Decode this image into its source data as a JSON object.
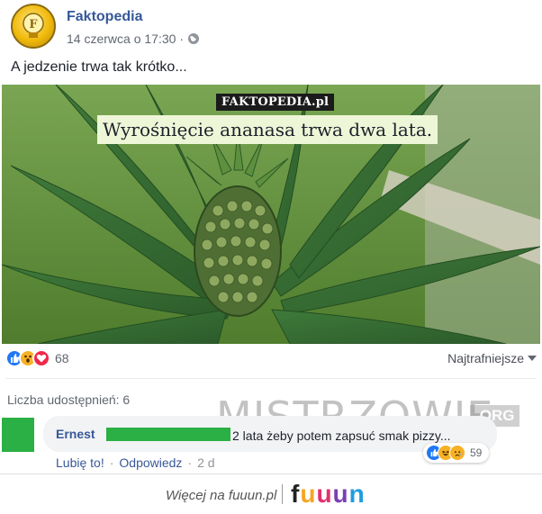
{
  "post": {
    "page_name": "Faktopedia",
    "date": "14 czerwca o 17:30",
    "date_separator": "·",
    "caption": "A jedzenie trwa tak krótko...",
    "image": {
      "brand_tag": "FAKTOPEDIA.pl",
      "fact_text": "Wyrośnięcie ananasa trwa dwa lata."
    }
  },
  "reactions": {
    "icons": [
      "like-icon",
      "wow-icon",
      "love-icon"
    ],
    "count": "68",
    "sort_label": "Najtrafniejsze"
  },
  "shares": {
    "label": "Liczba udostępnień: 6"
  },
  "watermark": {
    "text": "MISTRZOWIE",
    "suffix": ".ORG"
  },
  "comment": {
    "author": "Ernest",
    "text": "2 lata żeby potem zapsuć smak pizzy...",
    "reaction_icons": [
      "like-icon",
      "haha-icon",
      "sad-icon"
    ],
    "reaction_count": "59",
    "like_label": "Lubię to!",
    "reply_label": "Odpowiedz",
    "separator": "·",
    "time": "2 d"
  },
  "footer": {
    "text": "Więcej na fuuun.pl",
    "logo_letters": [
      "f",
      "u",
      "u",
      "u",
      "n"
    ],
    "logo_colors": [
      "#222222",
      "#f5a623",
      "#e2316d",
      "#7b3fb5",
      "#1f9de0"
    ]
  },
  "colors": {
    "link_blue": "#365899",
    "meta_gray": "#616770",
    "like_blue": "#2078f4",
    "love_red": "#f0284a",
    "wow_yellow": "#f7b125",
    "censor_green": "#2ab044"
  }
}
